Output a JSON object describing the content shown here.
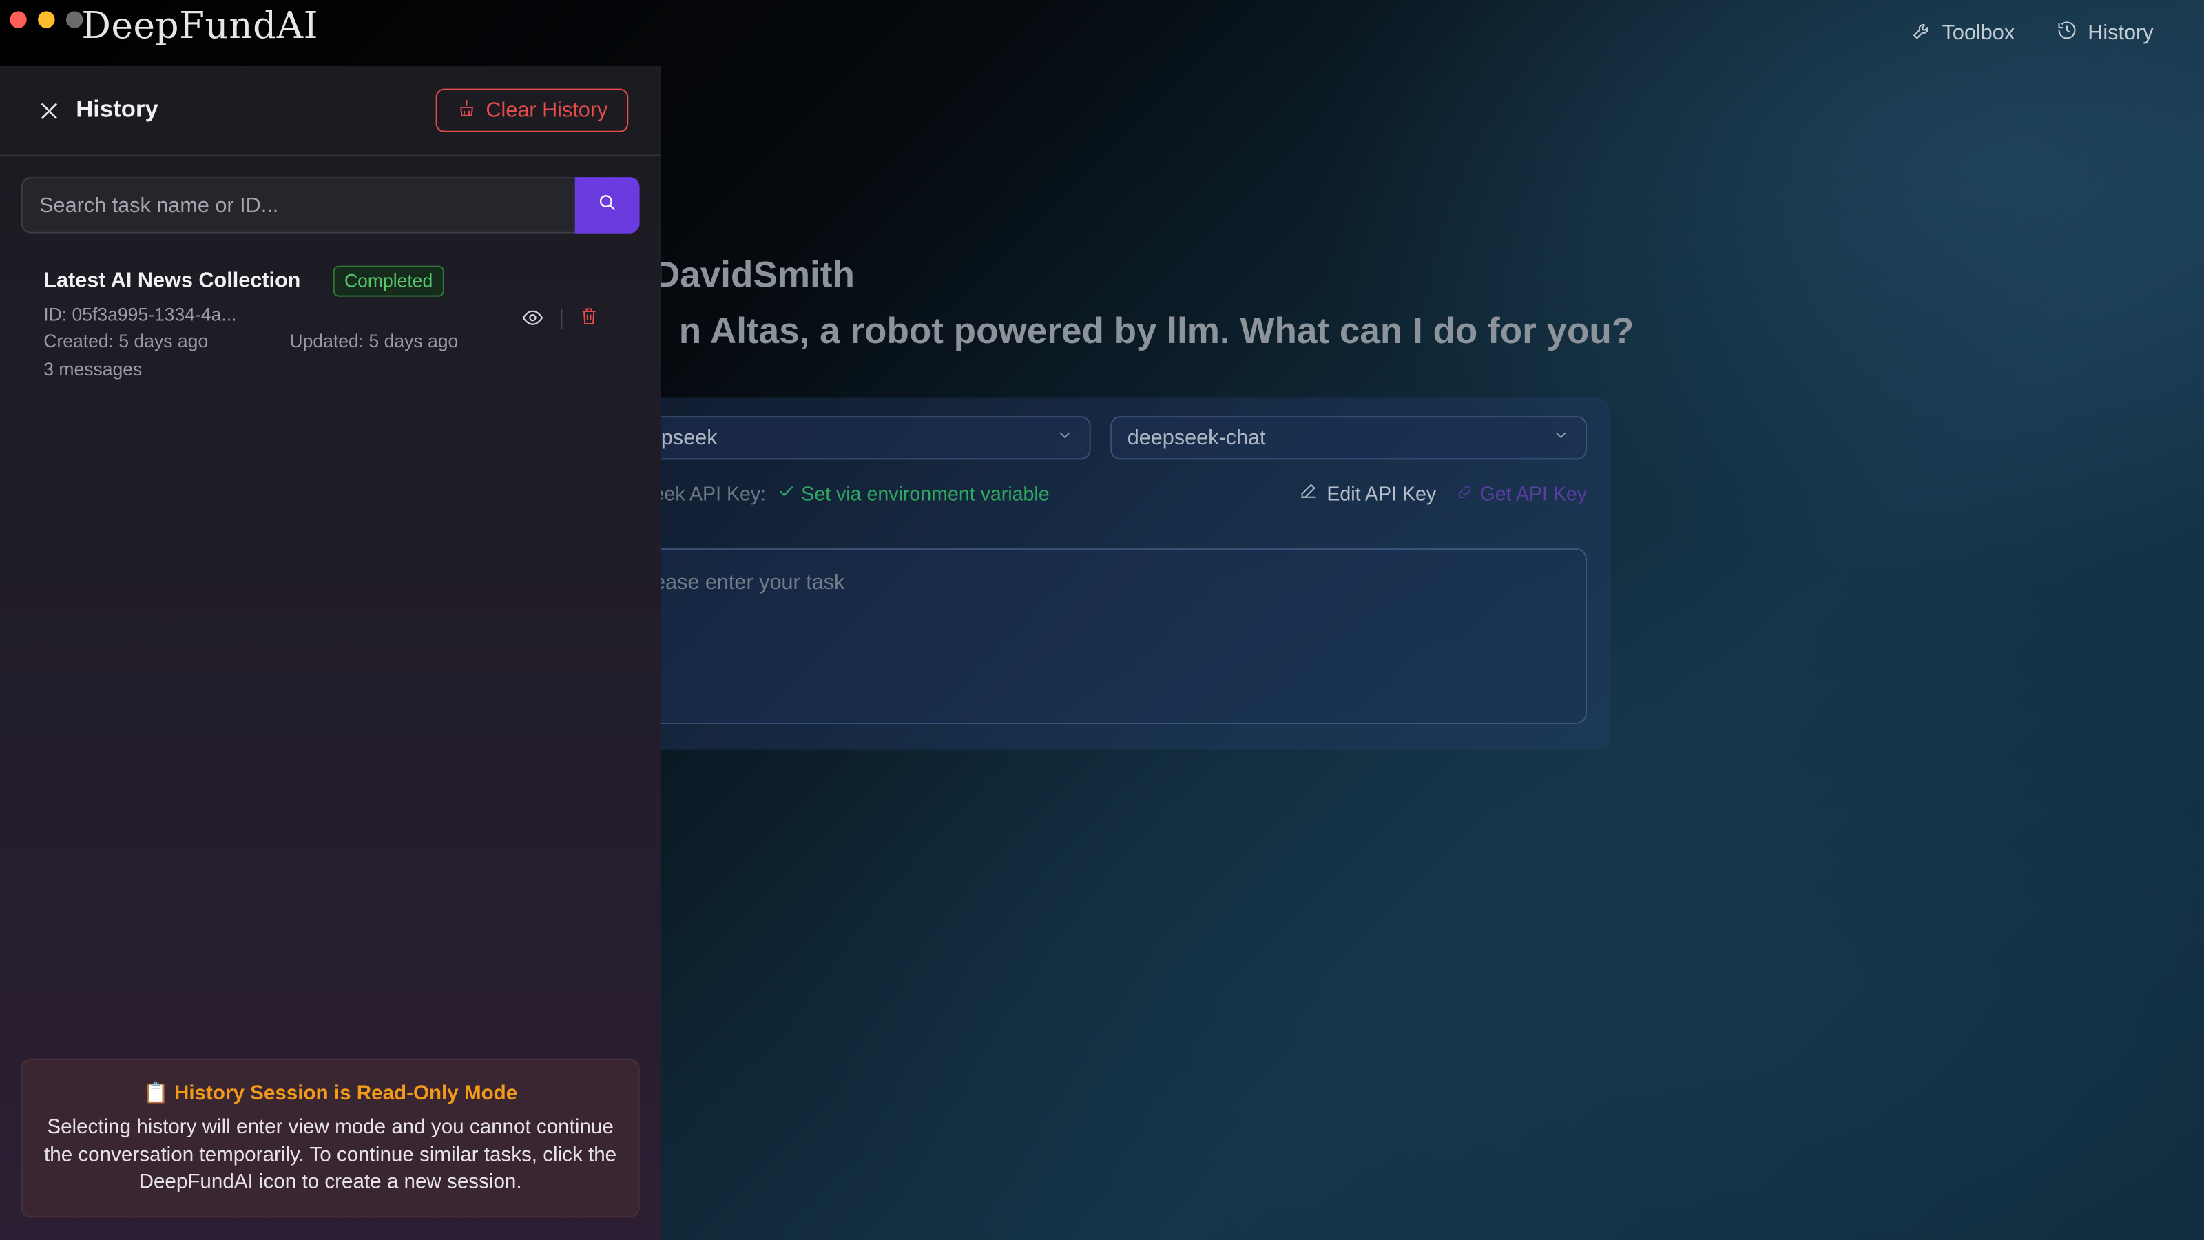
{
  "app": {
    "brand": "DeepFundAI"
  },
  "topnav": {
    "toolbox_label": "Toolbox",
    "history_label": "History"
  },
  "greeting": {
    "line1": "DavidSmith",
    "line2": "n Altas, a robot powered by llm. What can I do for you?"
  },
  "config": {
    "provider_value": "epseek",
    "model_value": "deepseek-chat",
    "api_key_label": "pseek API Key:",
    "api_key_status": "Set via environment variable",
    "edit_api_key": "Edit API Key",
    "get_api_key": "Get API Key",
    "task_placeholder": "ease enter your task"
  },
  "drawer": {
    "title": "History",
    "clear_label": "Clear History",
    "search_placeholder": "Search task name or ID...",
    "items": [
      {
        "name": "Latest AI News Collection",
        "status": "Completed",
        "id": "ID: 05f3a995-1334-4a...",
        "created": "Created: 5 days ago",
        "updated": "Updated: 5 days ago",
        "messages": "3 messages"
      }
    ],
    "notice": {
      "icon": "📋",
      "title": "History Session is Read-Only Mode",
      "body": "Selecting history will enter view mode and you cannot continue the conversation temporarily. To continue similar tasks, click the DeepFundAI icon to create a new session."
    }
  },
  "colors": {
    "accent": "#6c3be0",
    "danger": "#e84c4c",
    "success": "#56c46a",
    "warning": "#f29a1a"
  }
}
